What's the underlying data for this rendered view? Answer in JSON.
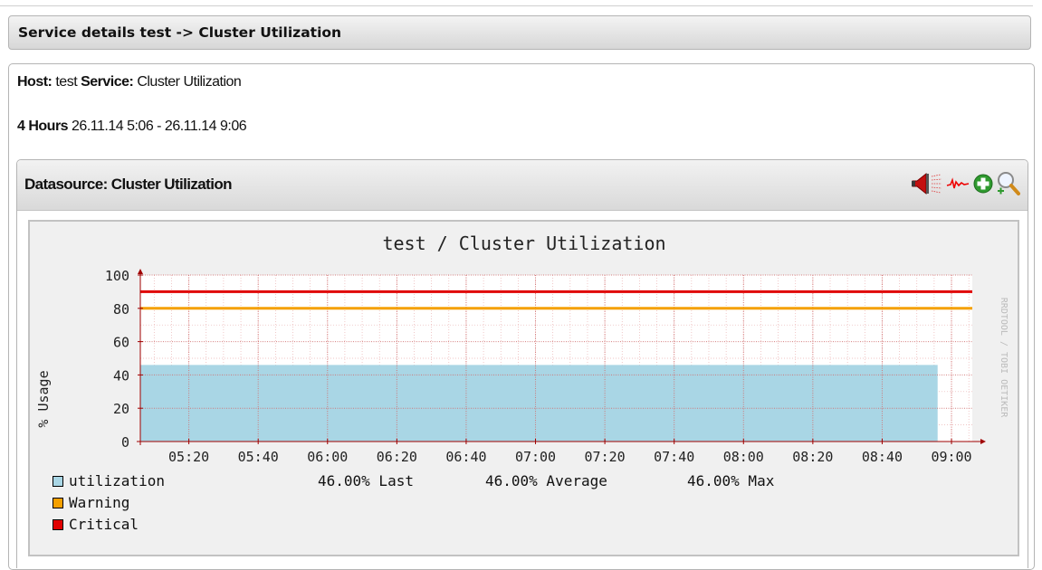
{
  "page": {
    "header_title": "Service details test -> Cluster Utilization"
  },
  "info": {
    "host_label": "Host:",
    "host_value": "test",
    "service_label": "Service:",
    "service_value": "Cluster Utilization",
    "period_label": "4 Hours",
    "period_range": "26.11.14 5:06 - 26.11.14 9:06"
  },
  "datasource": {
    "title": "Datasource: Cluster Utilization",
    "icons": [
      "megaphone-icon",
      "graph-line-icon",
      "add-icon",
      "zoom-icon"
    ]
  },
  "colors": {
    "utilization": "#a9d6e5",
    "warning": "#f5a000",
    "critical": "#e00000",
    "grid": "#e6a0a0",
    "axis": "#a00000"
  },
  "chart_data": {
    "type": "area",
    "title": "test / Cluster Utilization",
    "xlabel": "",
    "ylabel": "% Usage",
    "watermark": "RRDTOOL / TOBI OETIKER",
    "x_ticks": [
      "05:20",
      "05:40",
      "06:00",
      "06:20",
      "06:40",
      "07:00",
      "07:20",
      "07:40",
      "08:00",
      "08:20",
      "08:40",
      "09:00"
    ],
    "y_ticks": [
      0,
      20,
      40,
      60,
      80,
      100
    ],
    "xlim": [
      "05:06",
      "09:06"
    ],
    "ylim": [
      0,
      100
    ],
    "grid": true,
    "series": [
      {
        "name": "utilization",
        "type": "area",
        "x": [
          "05:06",
          "08:56"
        ],
        "values": [
          46,
          46
        ],
        "last": "46.00% Last",
        "average": "46.00% Average",
        "max": "46.00% Max"
      },
      {
        "name": "Warning",
        "type": "hline",
        "values": [
          80
        ]
      },
      {
        "name": "Critical",
        "type": "hline",
        "values": [
          90
        ]
      }
    ]
  }
}
